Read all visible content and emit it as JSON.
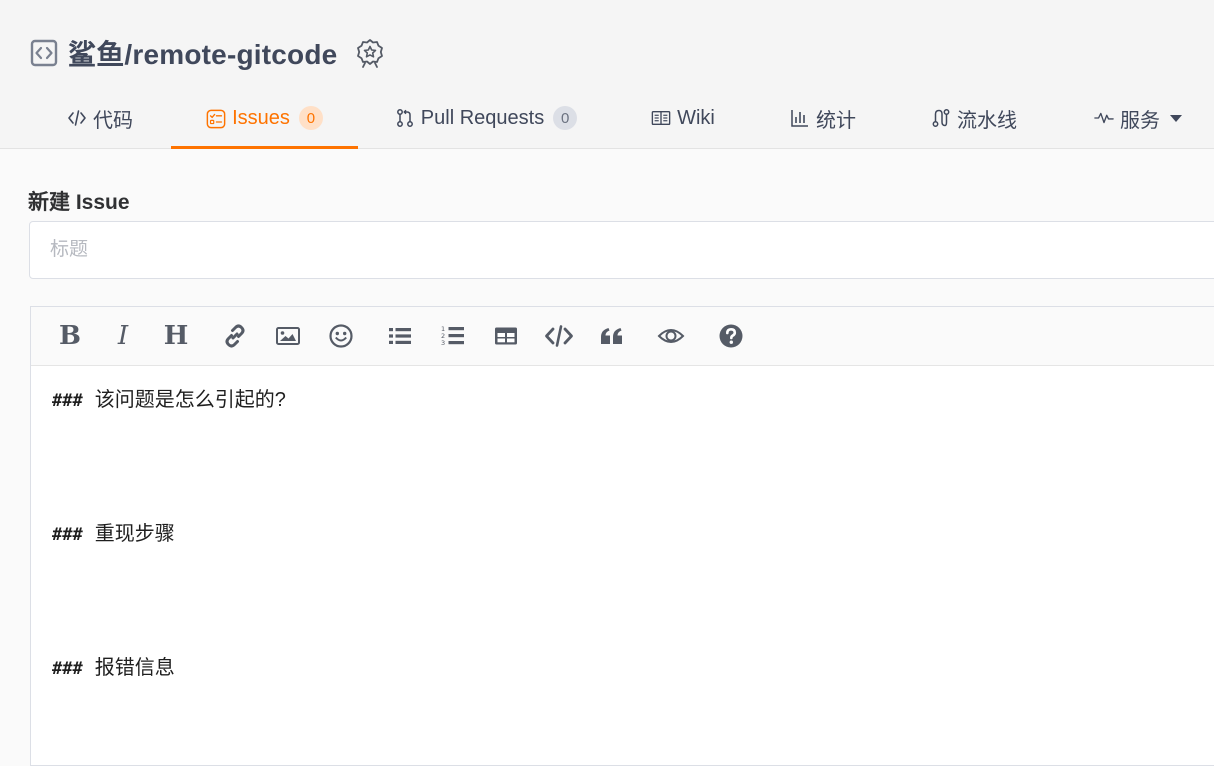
{
  "repo": {
    "name": "鲨鱼/remote-gitcode",
    "repo_icon": "code-repo-icon",
    "badge_icon": "award-badge-icon"
  },
  "tabs": [
    {
      "label": "代码",
      "icon": "code-icon"
    },
    {
      "label": "Issues",
      "icon": "issues-icon",
      "count": "0",
      "active": true
    },
    {
      "label": "Pull Requests",
      "icon": "pull-request-icon",
      "count": "0"
    },
    {
      "label": "Wiki",
      "icon": "book-icon"
    },
    {
      "label": "统计",
      "icon": "bar-chart-icon"
    },
    {
      "label": "流水线",
      "icon": "pipeline-icon"
    },
    {
      "label": "服务",
      "icon": "pulse-icon"
    }
  ],
  "form": {
    "heading": "新建 Issue",
    "title_placeholder": "标题",
    "title_value": ""
  },
  "toolbar": {
    "bold": "B",
    "italic": "I",
    "heading": "H",
    "icons": [
      "bold-icon",
      "italic-icon",
      "heading-icon",
      "link-icon",
      "image-icon",
      "emoji-icon",
      "bullet-list-icon",
      "numbered-list-icon",
      "table-icon",
      "code-icon",
      "quote-icon",
      "preview-eye-icon",
      "help-icon"
    ]
  },
  "editor": {
    "lines": [
      {
        "prefix": "###",
        "text": "该问题是怎么引起的?"
      },
      {
        "prefix": "###",
        "text": "重现步骤"
      },
      {
        "prefix": "###",
        "text": "报错信息"
      }
    ]
  },
  "colors": {
    "accent": "#fe7300",
    "text": "#40485b",
    "border": "#dcdfe6"
  }
}
